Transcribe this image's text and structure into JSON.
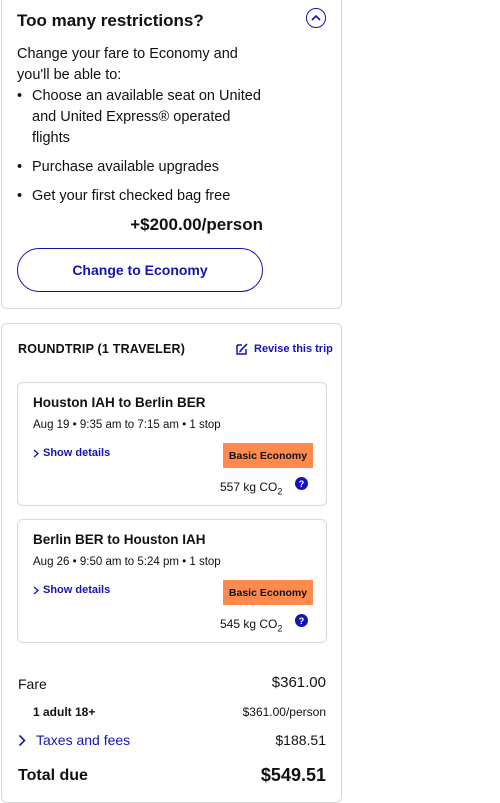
{
  "restrictions": {
    "title": "Too many restrictions?",
    "intro": "Change your fare to Economy and you'll be able to:",
    "benefits": [
      "Choose an available seat on United and United Express® operated flights",
      "Purchase available upgrades",
      "Get your first checked bag free"
    ],
    "price_delta": "+$200.00/person",
    "change_button": "Change to Economy"
  },
  "summary": {
    "title": "ROUNDTRIP (1 TRAVELER)",
    "revise_label": "Revise this trip",
    "flights": [
      {
        "route": "Houston IAH to Berlin BER",
        "times": "Aug 19 • 9:35 am to 7:15 am • 1 stop",
        "details_label": "Show details",
        "fare_class": "Basic Economy",
        "co2": "557 kg CO",
        "co2_sub": "2"
      },
      {
        "route": "Berlin BER to Houston IAH",
        "times": "Aug 26 • 9:50 am to 5:24 pm • 1 stop",
        "details_label": "Show details",
        "fare_class": "Basic Economy",
        "co2": "545 kg CO",
        "co2_sub": "2"
      }
    ],
    "fare_label": "Fare",
    "fare_value": "$361.00",
    "adult_label": "1 adult 18+",
    "adult_value": "$361.00/person",
    "taxes_label": "Taxes and fees",
    "taxes_value": "$188.51",
    "total_label": "Total due",
    "total_value": "$549.51"
  },
  "colors": {
    "accent": "#1414b4",
    "badge": "#ff8a4e",
    "border": "#d8d8d8"
  },
  "icons": {
    "collapse": "chevron-up-icon",
    "revise": "edit-icon",
    "details": "chevron-right-icon",
    "help": "help-icon",
    "taxes": "chevron-right-icon"
  }
}
